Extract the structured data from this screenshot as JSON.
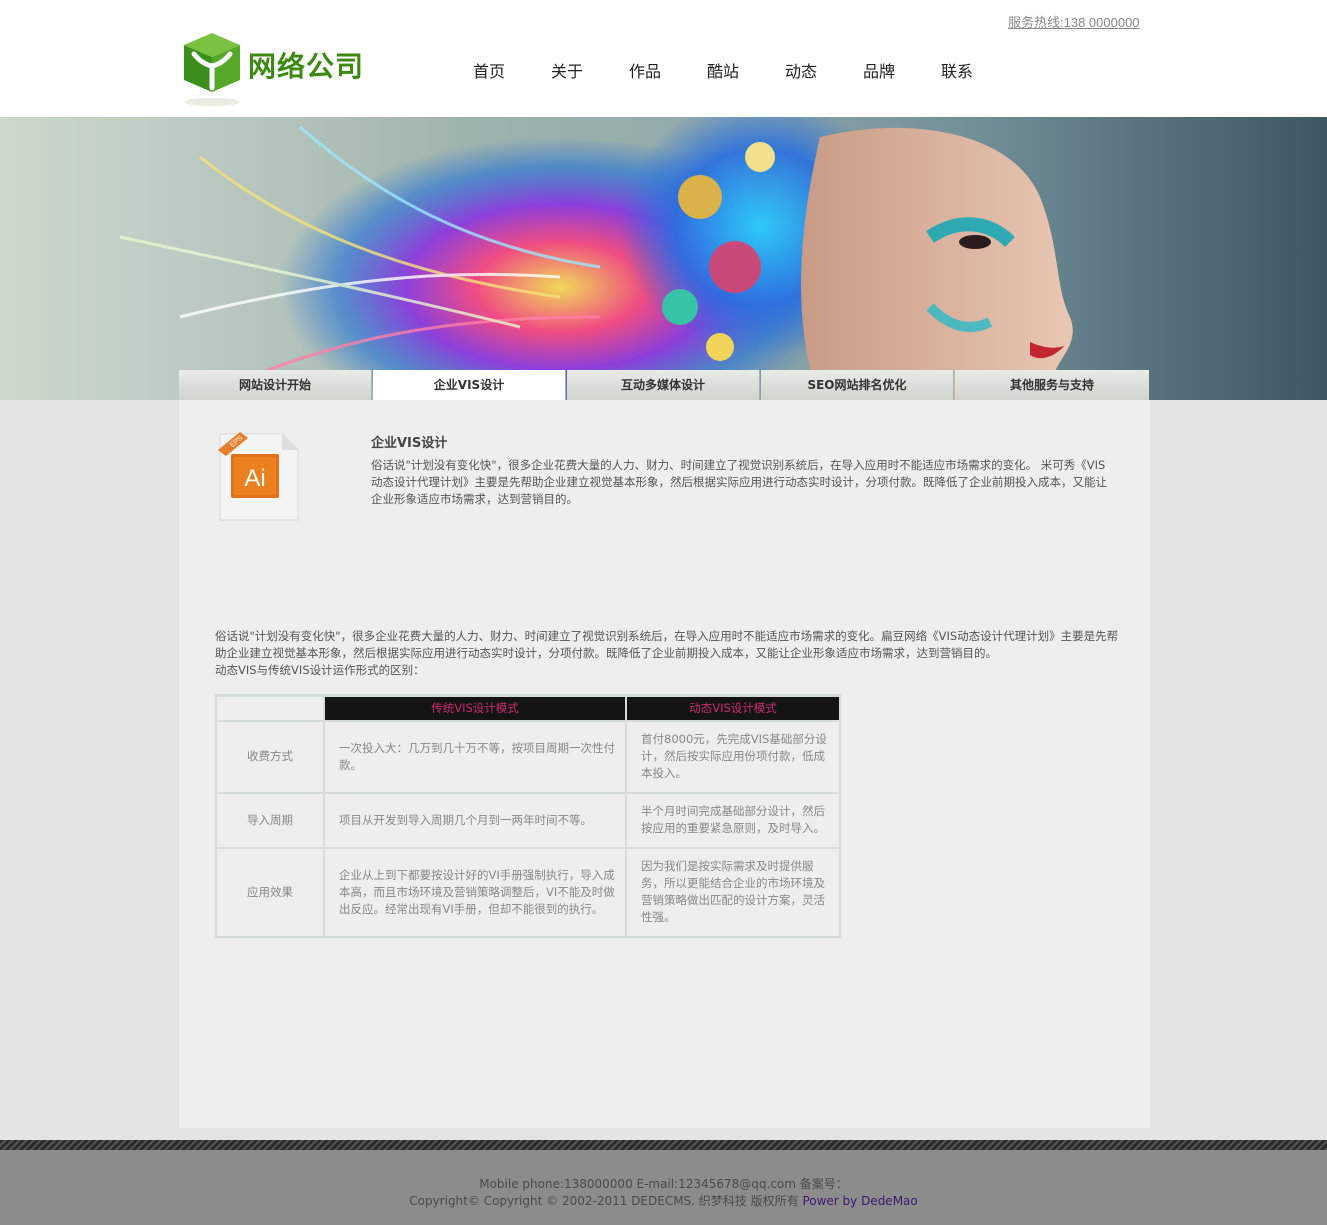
{
  "header": {
    "hotline": "服务热线:138 0000000",
    "logo_text": "网络公司",
    "nav": [
      "首页",
      "关于",
      "作品",
      "酷站",
      "动态",
      "品牌",
      "联系"
    ]
  },
  "tabs": [
    "网站设计开始",
    "企业VIS设计",
    "互动多媒体设计",
    "SEO网站排名优化",
    "其他服务与支持"
  ],
  "active_tab": 1,
  "icon_label": {
    "badge": "EPS",
    "name": "Ai"
  },
  "intro": {
    "title": "企业VIS设计",
    "text": "俗话说\"计划没有变化快\"，很多企业花费大量的人力、财力、时间建立了视觉识别系统后，在导入应用时不能适应市场需求的变化。 米可秀《VIS动态设计代理计划》主要是先帮助企业建立视觉基本形象，然后根据实际应用进行动态实时设计，分项付款。既降低了企业前期投入成本，又能让企业形象适应市场需求，达到营销目的。"
  },
  "body_text": {
    "p1": "俗话说\"计划没有变化快\"，很多企业花费大量的人力、财力、时间建立了视觉识别系统后，在导入应用时不能适应市场需求的变化。扁豆网络《VIS动态设计代理计划》主要是先帮助企业建立视觉基本形象，然后根据实际应用进行动态实时设计，分项付款。既降低了企业前期投入成本，又能让企业形象适应市场需求，达到营销目的。",
    "p2": "动态VIS与传统VIS设计运作形式的区别："
  },
  "table": {
    "headers": [
      "",
      "传统VIS设计模式",
      "动态VIS设计模式"
    ],
    "rows": [
      {
        "label": "收费方式",
        "traditional": "一次投入大：几万到几十万不等，按项目周期一次性付款。",
        "dynamic": "首付8000元，先完成VIS基础部分设计，然后按实际应用份项付款，低成本投入。"
      },
      {
        "label": "导入周期",
        "traditional": "项目从开发到导入周期几个月到一两年时间不等。",
        "dynamic": "半个月时间完成基础部分设计，然后按应用的重要紧急原则，及时导入。"
      },
      {
        "label": "应用效果",
        "traditional": "企业从上到下都要按设计好的VI手册强制执行，导入成本高，而且市场环境及营销策略调整后，VI不能及时做出反应。经常出现有VI手册，但却不能很到的执行。",
        "dynamic": "因为我们是按实际需求及时提供服务，所以更能结合企业的市场环境及营销策略做出匹配的设计方案，灵活性强。"
      }
    ]
  },
  "footer": {
    "line1": "Mobile phone:138000000  E-mail:12345678@qq.com  备案号：",
    "line2": "Copyright© Copyright © 2002-2011 DEDECMS. 织梦科技 版权所有 ",
    "power": "Power by DedeMao"
  },
  "colors": {
    "logo_green": "#3d8a12",
    "table_header_bg": "#141414",
    "table_header_text": "#cc2a6e",
    "footer_bg": "#8c8c8c"
  }
}
